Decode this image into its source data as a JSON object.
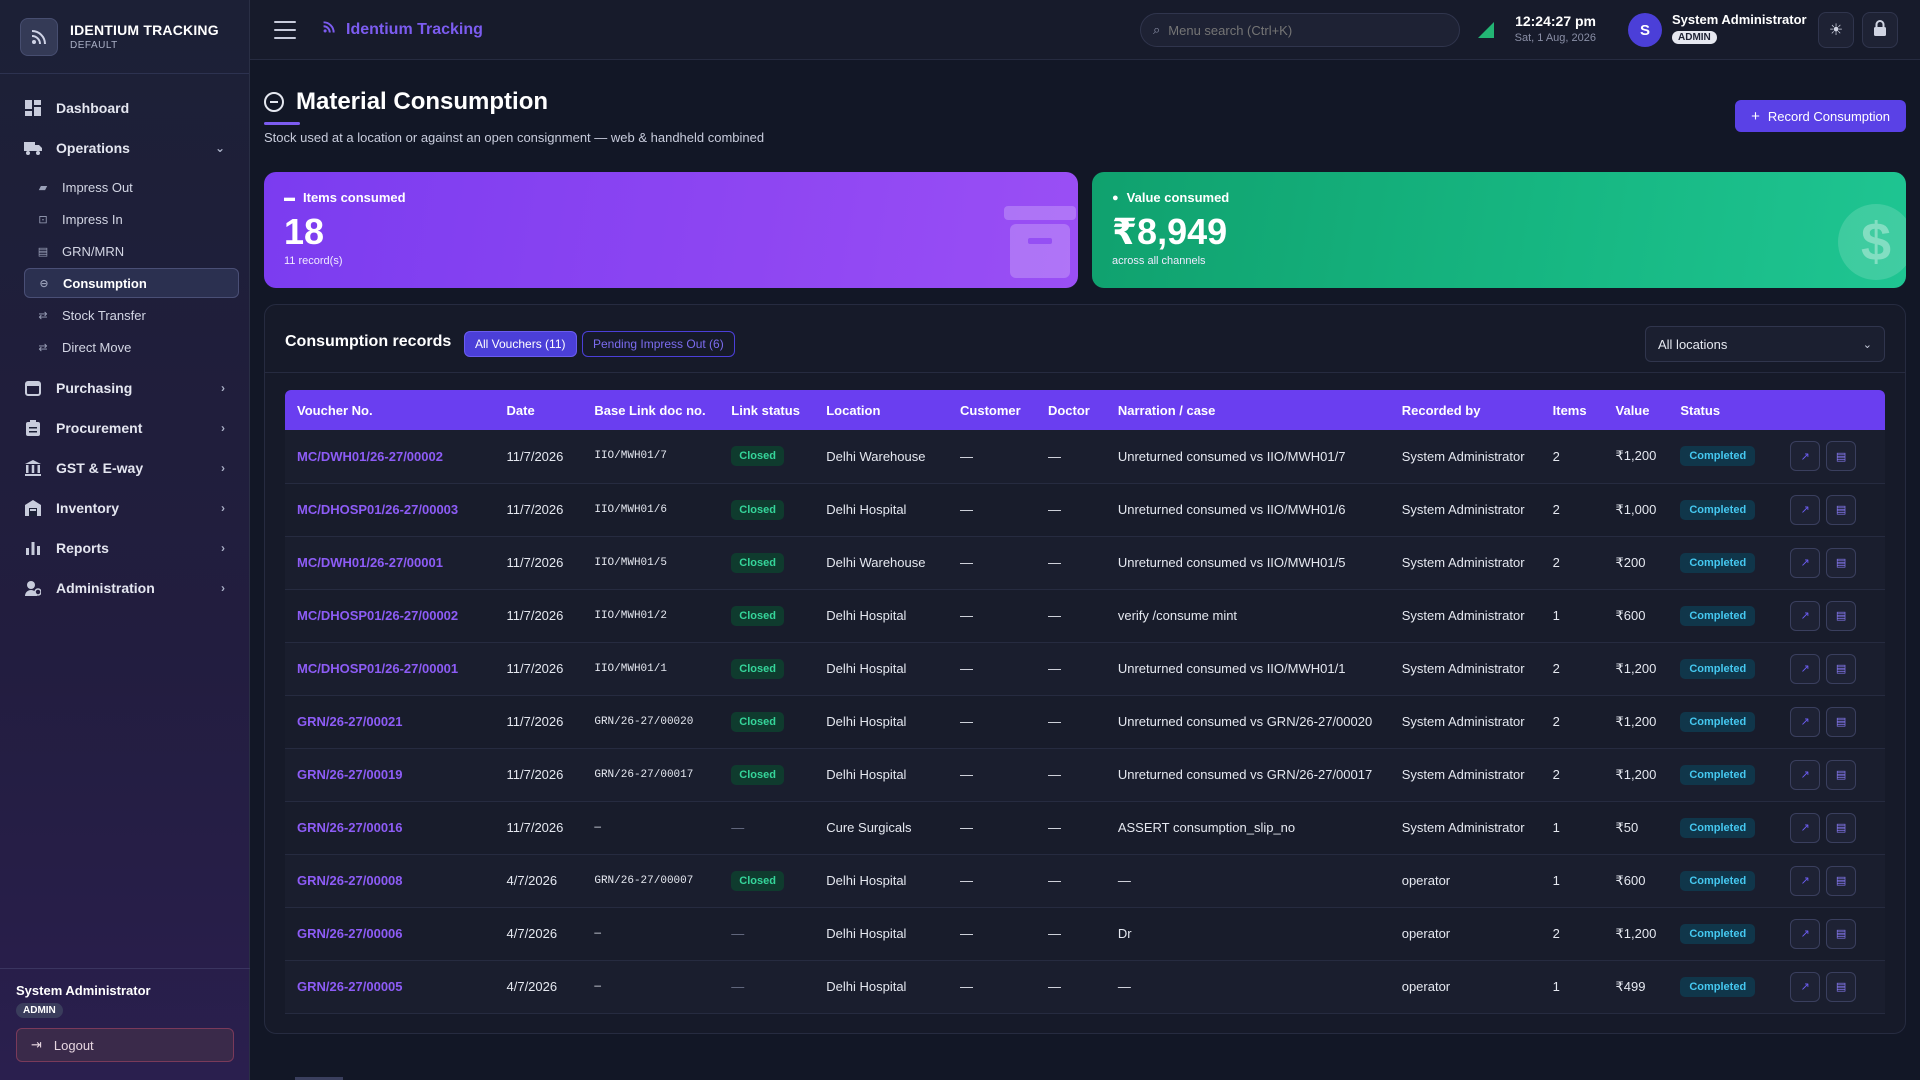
{
  "sidebar": {
    "brand_title": "IDENTIUM TRACKING",
    "brand_sub": "DEFAULT",
    "items": {
      "dashboard": "Dashboard",
      "operations": "Operations",
      "purchasing": "Purchasing",
      "procurement": "Procurement",
      "gst": "GST & E-way",
      "inventory": "Inventory",
      "reports": "Reports",
      "administration": "Administration"
    },
    "sub_items": {
      "impress_out": "Impress Out",
      "impress_in": "Impress In",
      "grn_mrn": "GRN/MRN",
      "consumption": "Consumption",
      "stock_transfer": "Stock Transfer",
      "direct_move": "Direct Move"
    },
    "footer": {
      "user": "System Administrator",
      "role": "ADMIN",
      "logout": "Logout"
    }
  },
  "header": {
    "breadcrumb": "Identium Tracking",
    "search_placeholder": "Menu search (Ctrl+K)",
    "time": "12:24:27 pm",
    "date": "Sat, 1 Aug, 2026",
    "avatar_initial": "S",
    "user": "System Administrator",
    "role": "ADMIN"
  },
  "page": {
    "title": "Material Consumption",
    "subtitle": "Stock used at a location or against an open consignment — web & handheld combined",
    "record_button": "Record Consumption"
  },
  "stats": {
    "items": {
      "label": "Items consumed",
      "value": "18",
      "caption": "11 record(s)"
    },
    "value": {
      "label": "Value consumed",
      "value": "₹8,949",
      "caption": "across all channels"
    }
  },
  "records": {
    "title": "Consumption records",
    "tab_all": "All Vouchers (11)",
    "tab_pending": "Pending Impress Out (6)",
    "location_filter": "All locations",
    "columns": [
      "Voucher No.",
      "Date",
      "Base Link doc no.",
      "Link status",
      "Location",
      "Customer",
      "Doctor",
      "Narration / case",
      "Recorded by",
      "Items",
      "Value",
      "Status"
    ],
    "rows": [
      {
        "voucher": "MC/DWH01/26-27/00002",
        "date": "11/7/2026",
        "base": "IIO/MWH01/7",
        "link": "Closed",
        "location": "Delhi Warehouse",
        "customer": "—",
        "doctor": "—",
        "narration": "Unreturned consumed vs IIO/MWH01/7",
        "recorded_by": "System Administrator",
        "items": "2",
        "value": "₹1,200",
        "status": "Completed"
      },
      {
        "voucher": "MC/DHOSP01/26-27/00003",
        "date": "11/7/2026",
        "base": "IIO/MWH01/6",
        "link": "Closed",
        "location": "Delhi Hospital",
        "customer": "—",
        "doctor": "—",
        "narration": "Unreturned consumed vs IIO/MWH01/6",
        "recorded_by": "System Administrator",
        "items": "2",
        "value": "₹1,000",
        "status": "Completed"
      },
      {
        "voucher": "MC/DWH01/26-27/00001",
        "date": "11/7/2026",
        "base": "IIO/MWH01/5",
        "link": "Closed",
        "location": "Delhi Warehouse",
        "customer": "—",
        "doctor": "—",
        "narration": "Unreturned consumed vs IIO/MWH01/5",
        "recorded_by": "System Administrator",
        "items": "2",
        "value": "₹200",
        "status": "Completed"
      },
      {
        "voucher": "MC/DHOSP01/26-27/00002",
        "date": "11/7/2026",
        "base": "IIO/MWH01/2",
        "link": "Closed",
        "location": "Delhi Hospital",
        "customer": "—",
        "doctor": "—",
        "narration": "verify /consume mint",
        "recorded_by": "System Administrator",
        "items": "1",
        "value": "₹600",
        "status": "Completed"
      },
      {
        "voucher": "MC/DHOSP01/26-27/00001",
        "date": "11/7/2026",
        "base": "IIO/MWH01/1",
        "link": "Closed",
        "location": "Delhi Hospital",
        "customer": "—",
        "doctor": "—",
        "narration": "Unreturned consumed vs IIO/MWH01/1",
        "recorded_by": "System Administrator",
        "items": "2",
        "value": "₹1,200",
        "status": "Completed"
      },
      {
        "voucher": "GRN/26-27/00021",
        "date": "11/7/2026",
        "base": "GRN/26-27/00020",
        "link": "Closed",
        "location": "Delhi Hospital",
        "customer": "—",
        "doctor": "—",
        "narration": "Unreturned consumed vs GRN/26-27/00020",
        "recorded_by": "System Administrator",
        "items": "2",
        "value": "₹1,200",
        "status": "Completed"
      },
      {
        "voucher": "GRN/26-27/00019",
        "date": "11/7/2026",
        "base": "GRN/26-27/00017",
        "link": "Closed",
        "location": "Delhi Hospital",
        "customer": "—",
        "doctor": "—",
        "narration": "Unreturned consumed vs GRN/26-27/00017",
        "recorded_by": "System Administrator",
        "items": "2",
        "value": "₹1,200",
        "status": "Completed"
      },
      {
        "voucher": "GRN/26-27/00016",
        "date": "11/7/2026",
        "base": "—",
        "link": "—",
        "location": "Cure Surgicals",
        "customer": "—",
        "doctor": "—",
        "narration": "ASSERT consumption_slip_no",
        "recorded_by": "System Administrator",
        "items": "1",
        "value": "₹50",
        "status": "Completed"
      },
      {
        "voucher": "GRN/26-27/00008",
        "date": "4/7/2026",
        "base": "GRN/26-27/00007",
        "link": "Closed",
        "location": "Delhi Hospital",
        "customer": "—",
        "doctor": "—",
        "narration": "—",
        "recorded_by": "operator",
        "items": "1",
        "value": "₹600",
        "status": "Completed"
      },
      {
        "voucher": "GRN/26-27/00006",
        "date": "4/7/2026",
        "base": "—",
        "link": "—",
        "location": "Delhi Hospital",
        "customer": "—",
        "doctor": "—",
        "narration": "Dr",
        "recorded_by": "operator",
        "items": "2",
        "value": "₹1,200",
        "status": "Completed"
      },
      {
        "voucher": "GRN/26-27/00005",
        "date": "4/7/2026",
        "base": "—",
        "link": "—",
        "location": "Delhi Hospital",
        "customer": "—",
        "doctor": "—",
        "narration": "—",
        "recorded_by": "operator",
        "items": "1",
        "value": "₹499",
        "status": "Completed"
      }
    ]
  },
  "colors": {
    "accent": "#6a3ef0",
    "brand": "#7c5cf0",
    "success": "#17b883",
    "closed": "#35d59a",
    "completed": "#45c8f0"
  }
}
